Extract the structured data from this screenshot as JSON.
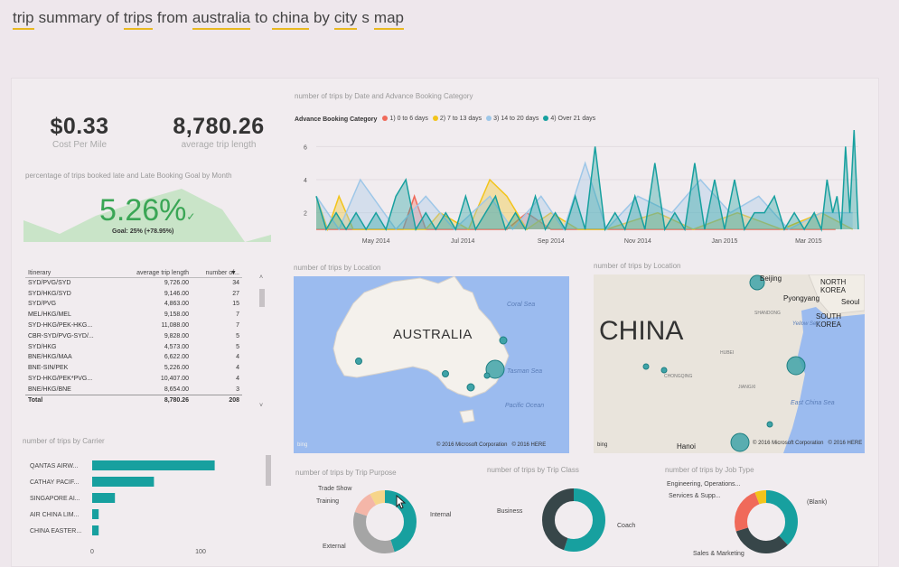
{
  "query_title": [
    {
      "text": "trip",
      "kw": true
    },
    {
      "text": "summary",
      "kw": false
    },
    {
      "text": "of",
      "kw": false
    },
    {
      "text": "trips",
      "kw": true
    },
    {
      "text": "from",
      "kw": false
    },
    {
      "text": "australia",
      "kw": true
    },
    {
      "text": "to",
      "kw": false
    },
    {
      "text": "china",
      "kw": true
    },
    {
      "text": "by",
      "kw": false
    },
    {
      "text": "city",
      "kw": true
    },
    {
      "text": "s",
      "kw": false
    },
    {
      "text": "map",
      "kw": true
    }
  ],
  "kpis": {
    "cost": {
      "value": "$0.33",
      "label": "Cost Per Mile"
    },
    "length": {
      "value": "8,780.26",
      "label": "average trip length"
    }
  },
  "late_booking": {
    "title": "percentage of trips booked late and Late Booking Goal by Month",
    "value": "5.26%",
    "goal": "Goal: 25% (+78.95%)",
    "colors": {
      "value": "#3aa655",
      "area": "#c9e4c8"
    }
  },
  "itinerary_table": {
    "columns": [
      "Itinerary",
      "average trip length",
      "number of..."
    ],
    "rows": [
      [
        "SYD/PVG/SYD",
        "9,726.00",
        "34"
      ],
      [
        "SYD/HKG/SYD",
        "9,146.00",
        "27"
      ],
      [
        "SYD/PVG",
        "4,863.00",
        "15"
      ],
      [
        "MEL/HKG/MEL",
        "9,158.00",
        "7"
      ],
      [
        "SYD-HKG/PEK-HKG...",
        "11,088.00",
        "7"
      ],
      [
        "CBR-SYD/PVG-SYD/...",
        "9,828.00",
        "5"
      ],
      [
        "SYD/HKG",
        "4,573.00",
        "5"
      ],
      [
        "BNE/HKG/MAA",
        "6,622.00",
        "4"
      ],
      [
        "BNE-SIN/PEK",
        "5,226.00",
        "4"
      ],
      [
        "SYD-HKG/PEK*PVG...",
        "10,407.00",
        "4"
      ],
      [
        "BNE/HKG/BNE",
        "8,654.00",
        "3"
      ]
    ],
    "total": [
      "Total",
      "8,780.26",
      "208"
    ]
  },
  "carrier": {
    "title": "number of trips by Carrier",
    "axis_ticks": [
      "0",
      "100"
    ]
  },
  "line_chart": {
    "title": "number of trips by Date and Advance Booking Category",
    "legend_title": "Advance Booking Category"
  },
  "map_au": {
    "title": "number of trips by Location",
    "country": "AUSTRALIA",
    "labels": {
      "coral": "Coral Sea",
      "tasman": "Tasman Sea",
      "pacific": "Pacific Ocean"
    },
    "footer": "© 2016 Microsoft Corporation   © 2016 HERE",
    "bing": "bing"
  },
  "map_cn": {
    "title": "number of trips by Location",
    "country": "CHINA",
    "labels": {
      "beijing": "Beijing",
      "nk": "NORTH KOREA",
      "pyongyang": "Pyongyang",
      "seoul": "Seoul",
      "sk": "SOUTH KOREA",
      "yellow": "Yellow Sea",
      "ecs": "East China Sea",
      "hanoi": "Hanoi",
      "chongqing": "CHONGQING",
      "hubei": "HUBEI",
      "jiangxi": "JIANGXI",
      "shandong": "SHANDONG"
    },
    "footer": "© 2016 Microsoft Corporation   © 2016 HERE",
    "bing": "bing"
  },
  "donuts": {
    "purpose": {
      "title": "number of trips by Trip Purpose",
      "labels": [
        "Trade Show",
        "Training",
        "Internal",
        "External"
      ]
    },
    "class": {
      "title": "number of trips by Trip Class",
      "labels": [
        "Business",
        "Coach"
      ]
    },
    "job": {
      "title": "number of trips by Job Type",
      "labels": [
        "Engineering, Operations...",
        "Services & Supp...",
        "(Blank)",
        "Sales & Marketing"
      ]
    }
  },
  "chart_data": [
    {
      "type": "line",
      "title": "number of trips by Date and Advance Booking Category",
      "legend": {
        "title": "Advance Booking Category",
        "position": "top-left"
      },
      "x_ticks": [
        "May 2014",
        "Jul 2014",
        "Sep 2014",
        "Nov 2014",
        "Jan 2015",
        "Mar 2015"
      ],
      "ylim": [
        1,
        7
      ],
      "y_ticks": [
        2,
        4,
        6
      ],
      "x_range": [
        "2014-03-20",
        "2015-04-05"
      ],
      "series": [
        {
          "name": "1) 0 to 6 days",
          "color": "#f06a5a",
          "x": [
            "2014-03-20",
            "2014-04-02",
            "2014-05-05",
            "2014-05-20",
            "2014-05-28",
            "2014-06-05",
            "2014-08-01",
            "2014-08-15",
            "2014-09-01",
            "2014-09-20",
            "2014-10-05",
            "2014-11-10",
            "2015-01-05",
            "2015-02-15",
            "2015-03-20"
          ],
          "y": [
            1,
            1,
            1,
            1,
            3,
            1,
            1,
            2,
            1,
            1,
            1,
            1,
            1,
            1,
            1
          ]
        },
        {
          "name": "2) 7 to 13 days",
          "color": "#f2c41b",
          "x": [
            "2014-03-20",
            "2014-03-28",
            "2014-04-05",
            "2014-04-15",
            "2014-05-05",
            "2014-06-05",
            "2014-06-15",
            "2014-07-05",
            "2014-07-20",
            "2014-08-01",
            "2014-08-15",
            "2014-09-01",
            "2014-09-20",
            "2014-10-10",
            "2014-11-15",
            "2014-12-10",
            "2015-01-10",
            "2015-02-10",
            "2015-03-10",
            "2015-04-01"
          ],
          "y": [
            3,
            1,
            3,
            1,
            1,
            1,
            2,
            1,
            4,
            3,
            1,
            2,
            1,
            1,
            2,
            1,
            2,
            1,
            2,
            1
          ]
        },
        {
          "name": "3) 14 to 20 days",
          "color": "#9ec7e8",
          "x": [
            "2014-03-20",
            "2014-04-05",
            "2014-04-20",
            "2014-05-15",
            "2014-06-05",
            "2014-06-25",
            "2014-07-20",
            "2014-08-05",
            "2014-08-25",
            "2014-09-10",
            "2014-09-25",
            "2014-10-10",
            "2014-11-01",
            "2014-11-25",
            "2014-12-15",
            "2015-01-05",
            "2015-01-25",
            "2015-02-15",
            "2015-03-10",
            "2015-04-01"
          ],
          "y": [
            3,
            1,
            4,
            1,
            3,
            1,
            3,
            1,
            3,
            1,
            5,
            1,
            3,
            2,
            4,
            2,
            3,
            1,
            2,
            2
          ]
        },
        {
          "name": "4) Over 21 days",
          "color": "#17a09f",
          "x": [
            "2014-03-20",
            "2014-03-27",
            "2014-04-03",
            "2014-04-10",
            "2014-04-17",
            "2014-04-24",
            "2014-05-01",
            "2014-05-08",
            "2014-05-15",
            "2014-05-22",
            "2014-05-29",
            "2014-06-05",
            "2014-06-12",
            "2014-06-19",
            "2014-06-26",
            "2014-07-03",
            "2014-07-10",
            "2014-07-17",
            "2014-07-24",
            "2014-07-31",
            "2014-08-07",
            "2014-08-14",
            "2014-08-21",
            "2014-08-28",
            "2014-09-04",
            "2014-09-11",
            "2014-09-18",
            "2014-09-25",
            "2014-10-02",
            "2014-10-09",
            "2014-10-16",
            "2014-10-23",
            "2014-10-30",
            "2014-11-06",
            "2014-11-13",
            "2014-11-20",
            "2014-11-27",
            "2014-12-04",
            "2014-12-11",
            "2014-12-18",
            "2014-12-25",
            "2015-01-01",
            "2015-01-08",
            "2015-01-15",
            "2015-01-22",
            "2015-01-29",
            "2015-02-05",
            "2015-02-12",
            "2015-02-19",
            "2015-02-26",
            "2015-03-05",
            "2015-03-10",
            "2015-03-14",
            "2015-03-18",
            "2015-03-21",
            "2015-03-24",
            "2015-03-27",
            "2015-03-30",
            "2015-04-02",
            "2015-04-05"
          ],
          "y": [
            3,
            1,
            2,
            1,
            2,
            1,
            2,
            1,
            3,
            4,
            1,
            2,
            1,
            2,
            1,
            3,
            1,
            2,
            3,
            1,
            2,
            1,
            3,
            1,
            2,
            1,
            3,
            1,
            6,
            1,
            2,
            1,
            3,
            1,
            5,
            1,
            2,
            1,
            5,
            1,
            4,
            1,
            4,
            1,
            2,
            2,
            3,
            1,
            2,
            1,
            2,
            1,
            4,
            2,
            3,
            1,
            6,
            2,
            7,
            1
          ]
        }
      ]
    },
    {
      "type": "bar",
      "title": "number of trips by Carrier",
      "orientation": "horizontal",
      "categories": [
        "QANTAS AIRW...",
        "CATHAY PACIF...",
        "SINGAPORE AI...",
        "AIR CHINA LIM...",
        "CHINA EASTER..."
      ],
      "values": [
        113,
        57,
        21,
        6,
        6
      ],
      "xlim": [
        0,
        150
      ],
      "x_ticks": [
        0,
        100
      ],
      "color": "#17a09f"
    },
    {
      "type": "pie",
      "title": "number of trips by Trip Purpose",
      "labels": [
        "Internal",
        "External",
        "Training",
        "Trade Show"
      ],
      "values": [
        45,
        35,
        12,
        8
      ],
      "colors": [
        "#17a09f",
        "#a5a5a5",
        "#f4b6a8",
        "#f6d58a"
      ]
    },
    {
      "type": "pie",
      "title": "number of trips by Trip Class",
      "labels": [
        "Coach",
        "Business"
      ],
      "values": [
        55,
        45
      ],
      "colors": [
        "#17a09f",
        "#374649"
      ]
    },
    {
      "type": "pie",
      "title": "number of trips by Job Type",
      "labels": [
        "(Blank)",
        "Sales & Marketing",
        "Services & Supp...",
        "Engineering, Operations..."
      ],
      "values": [
        38,
        32,
        24,
        6
      ],
      "colors": [
        "#17a09f",
        "#374649",
        "#f06a5a",
        "#f2c41b"
      ]
    }
  ]
}
